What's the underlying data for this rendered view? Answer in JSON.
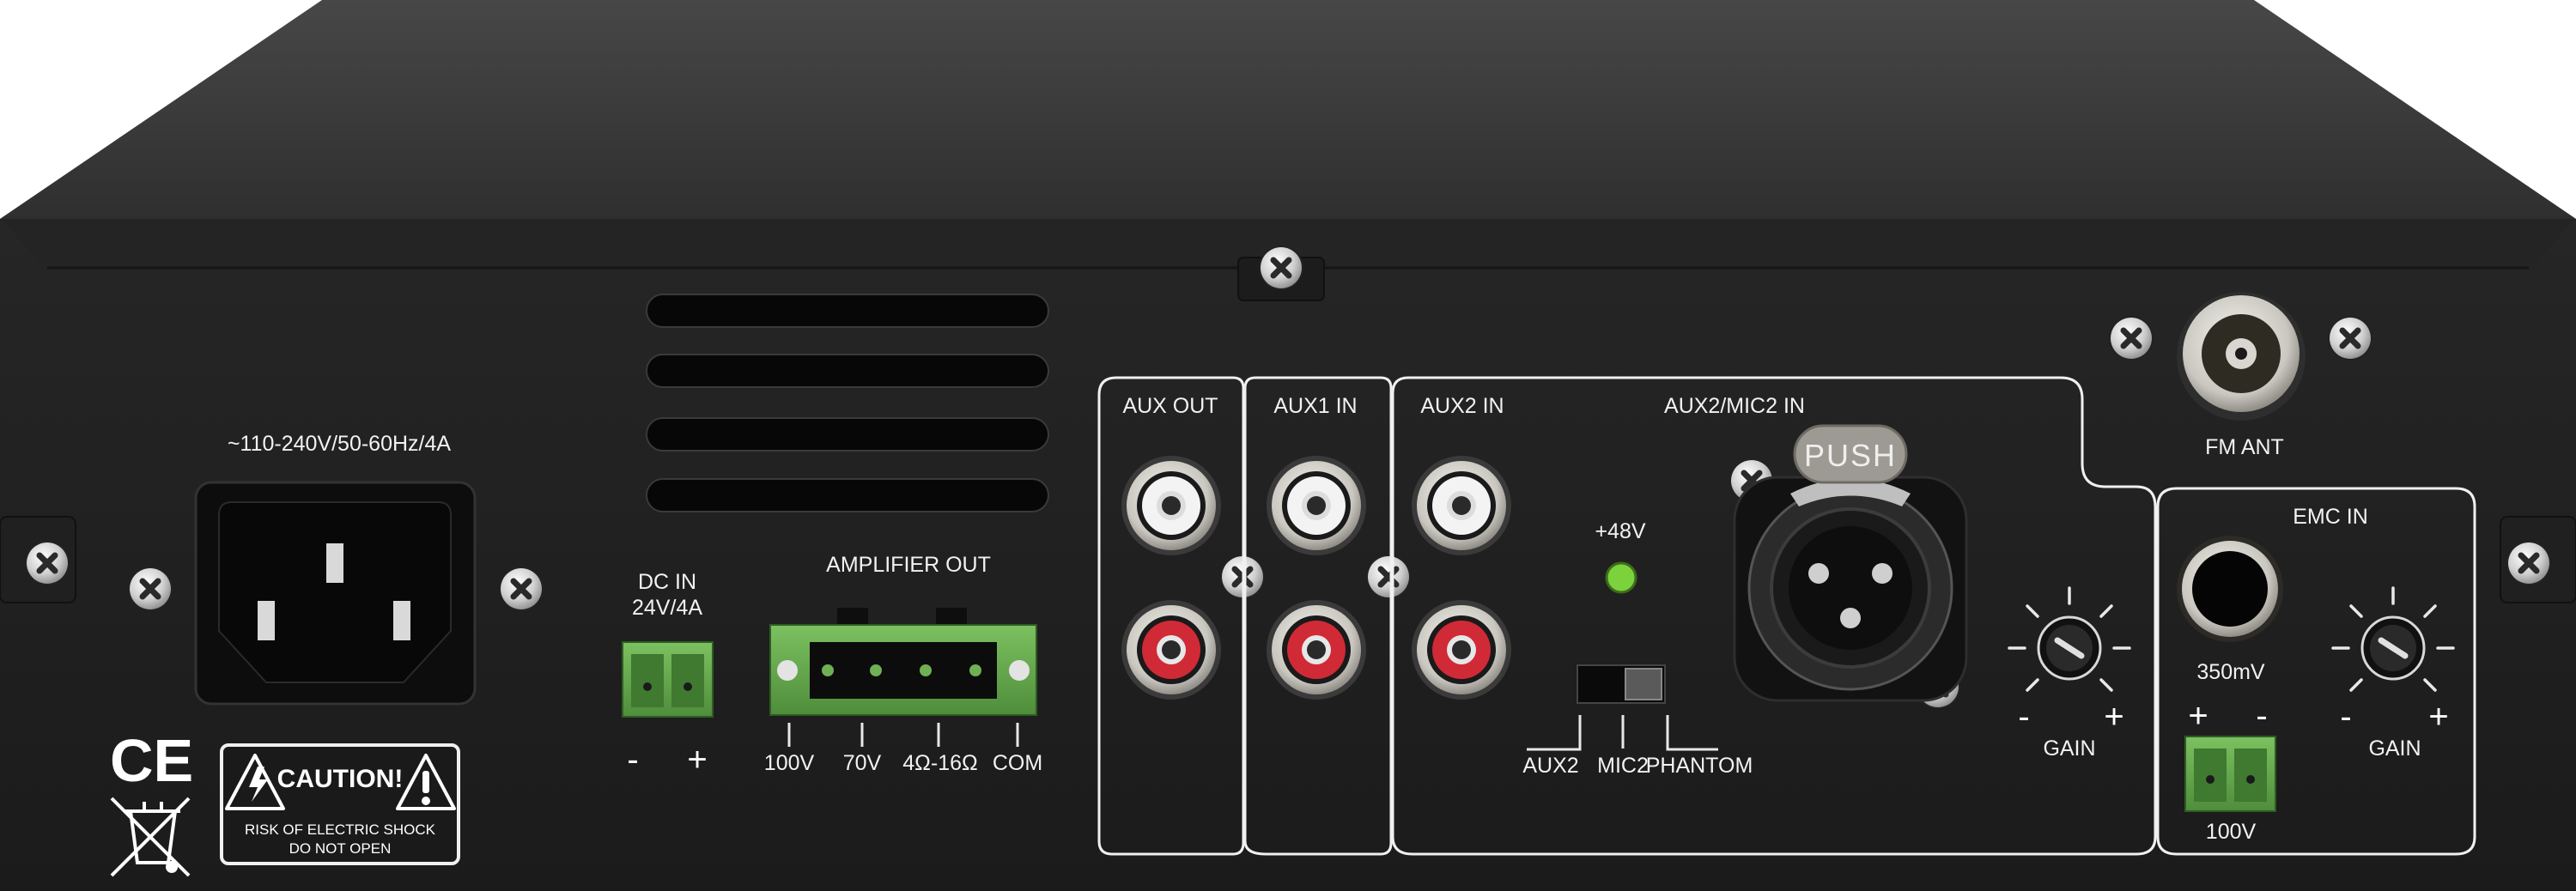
{
  "labels": {
    "power_rating": "~110-240V/50-60Hz/4A",
    "dc_in_line1": "DC  IN",
    "dc_in_line2": "24V/4A",
    "dc_minus": "-",
    "dc_plus": "+",
    "amplifier_out": "AMPLIFIER  OUT",
    "out_100v": "100V",
    "out_70v": "70V",
    "out_4_16ohm": "4Ω-16Ω",
    "out_com": "COM",
    "aux_out": "AUX OUT",
    "aux1_in": "AUX1 IN",
    "aux2_in": "AUX2 IN",
    "aux2_mic2_in": "AUX2/MIC2 IN",
    "push": "PUSH",
    "phantom_48v": "+48V",
    "switch_aux2": "AUX2",
    "switch_mic2": "MIC2",
    "switch_phantom": "PHANTOM",
    "gain_minus": "-",
    "gain_plus": "+",
    "gain": "GAIN",
    "fm_ant": "FM ANT",
    "emc_in": "EMC  IN",
    "emc_level": "350mV",
    "emc_plus": "+",
    "emc_minus": "-",
    "emc_terminal": "100V",
    "emc_gain_minus": "-",
    "emc_gain_plus": "+",
    "emc_gain": "GAIN",
    "ce_mark": "CE",
    "caution_title": "CAUTION!",
    "caution_line1": "RISK OF ELECTRIC SHOCK",
    "caution_line2": "DO NOT OPEN"
  },
  "colors": {
    "chassis_top": "#3a3a3a",
    "panel": "#1f1f1f",
    "terminal_green": "#5fa64a",
    "led_green": "#7bd23a",
    "rca_red": "#d02a36",
    "rca_white": "#e8e8e8"
  },
  "icons": [
    "screw-icon",
    "iec-power-socket-icon",
    "rca-jack-icon",
    "xlr-jack-icon",
    "knob-icon",
    "coax-jack-icon",
    "quarter-inch-jack-icon",
    "warning-triangle-icon",
    "weee-bin-icon"
  ]
}
